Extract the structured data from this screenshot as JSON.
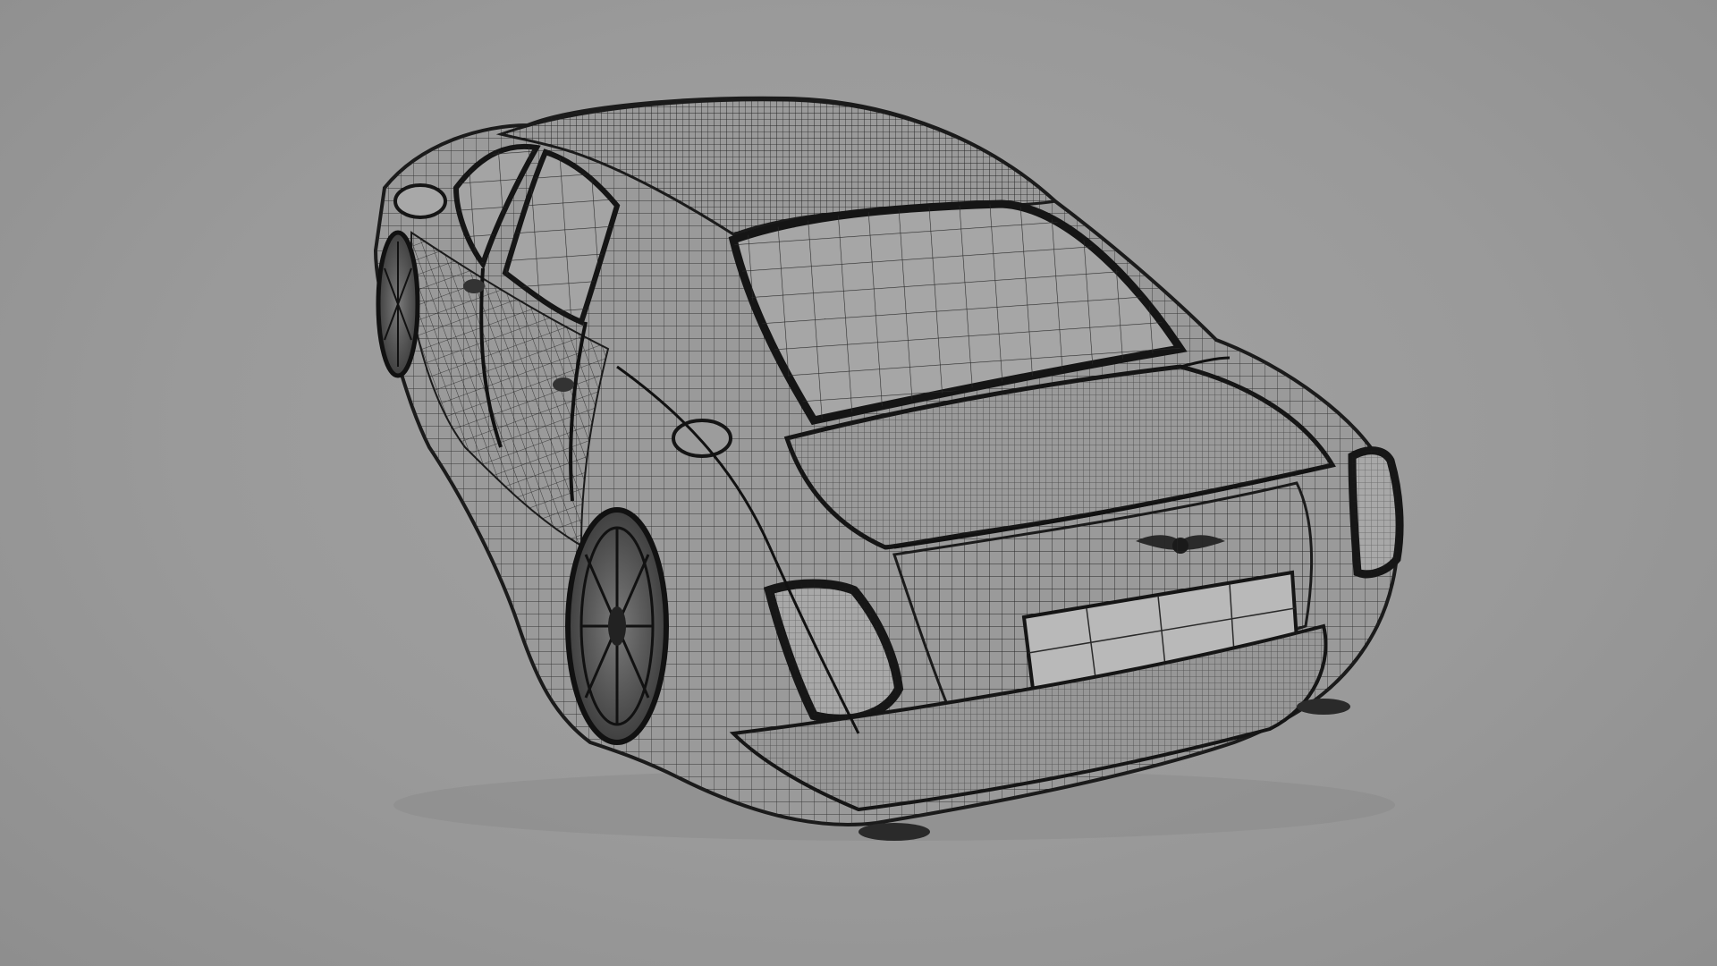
{
  "scene": {
    "subject": "car-wireframe-render",
    "background_color": "#9b9b9b",
    "wire_color": "#1e1e1e",
    "glass_color": "#a9a9a9",
    "plate_color": "#b8b8b8",
    "body_shade_color": "#8f8f8f"
  },
  "icons": {
    "badge": "winged-emblem-icon"
  }
}
